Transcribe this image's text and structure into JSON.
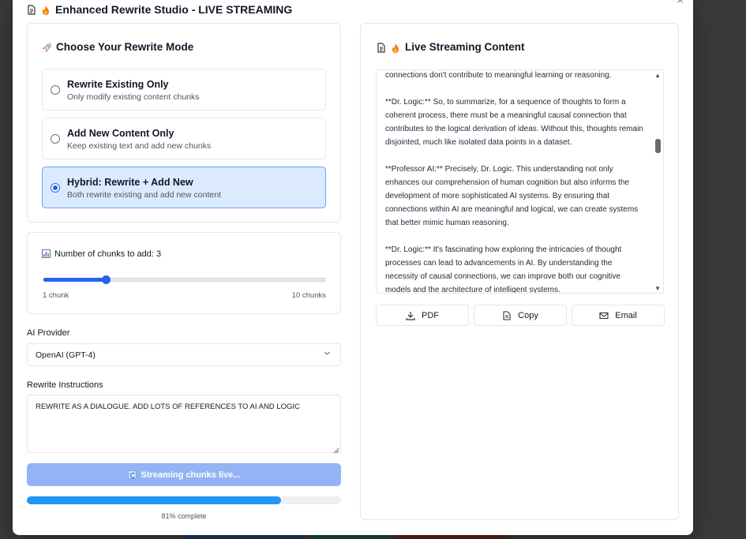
{
  "window": {
    "title": "Enhanced Rewrite Studio - LIVE STREAMING",
    "close_glyph": "×"
  },
  "mode_section": {
    "title": "Choose Your Rewrite Mode",
    "options": [
      {
        "label": "Rewrite Existing Only",
        "description": "Only modify existing content chunks",
        "selected": false
      },
      {
        "label": "Add New Content Only",
        "description": "Keep existing text and add new chunks",
        "selected": false
      },
      {
        "label": "Hybrid: Rewrite + Add New",
        "description": "Both rewrite existing and add new content",
        "selected": true
      }
    ]
  },
  "chunks": {
    "label": "Number of chunks to add: 3",
    "min_label": "1 chunk",
    "max_label": "10 chunks",
    "min": 1,
    "max": 10,
    "value": 3
  },
  "provider": {
    "label": "AI Provider",
    "value": "OpenAI (GPT-4)"
  },
  "instructions": {
    "label": "Rewrite Instructions",
    "value": "REWRITE AS A DIALOGUE. ADD LOTS OF REFERENCES TO AI AND LOGIC"
  },
  "stream_button": {
    "label": "Streaming chunks live..."
  },
  "progress": {
    "percent": 81,
    "text": "81% complete"
  },
  "live_content": {
    "title": "Live Streaming Content",
    "paragraphs": [
      "connections don't contribute to meaningful learning or reasoning.",
      "**Dr. Logic:** So, to summarize, for a sequence of thoughts to form a coherent process, there must be a meaningful causal connection that contributes to the logical derivation of ideas. Without this, thoughts remain disjointed, much like isolated data points in a dataset.",
      "**Professor AI:** Precisely, Dr. Logic. This understanding not only enhances our comprehension of human cognition but also informs the development of more sophisticated AI systems. By ensuring that connections within AI are meaningful and logical, we can create systems that better mimic human reasoning.",
      "**Dr. Logic:** It's fascinating how exploring the intricacies of thought processes can lead to advancements in AI. By understanding the necessity of causal connections, we can improve both our cognitive models and the architecture of intelligent systems."
    ]
  },
  "actions": {
    "pdf": "PDF",
    "copy": "Copy",
    "email": "Email"
  },
  "colors": {
    "accent": "#2563eb",
    "selected_bg": "#dbeafe",
    "stream_button_bg": "#93b4f4",
    "progress_fill": "#2196f3"
  },
  "icons": {
    "title": "document-icon",
    "fire": "fire-icon",
    "rocket": "rocket-icon",
    "chart": "bar-chart-icon",
    "spinner": "refresh-icon",
    "pdf": "download-icon",
    "copy": "copy-icon",
    "email": "mail-icon"
  }
}
